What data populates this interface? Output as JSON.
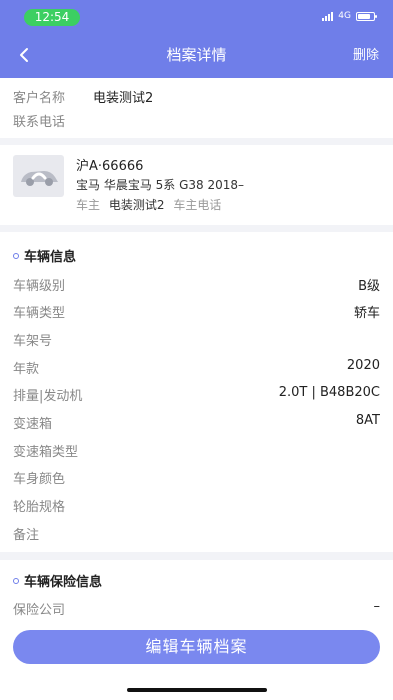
{
  "status_bar": {
    "time": "12:54",
    "network": "4G",
    "battery_level": 0.8
  },
  "header": {
    "title": "档案详情",
    "delete_label": "删除",
    "back_icon": "chevron-left-icon"
  },
  "customer": {
    "name_label": "客户名称",
    "name_value": "电装测试2",
    "phone_label": "联系电话",
    "phone_value": ""
  },
  "vehicle_card": {
    "plate": "沪A·66666",
    "model": "宝马 华晨宝马 5系 G38 2018–",
    "owner_label": "车主",
    "owner_value": "电装测试2",
    "owner_phone_label": "车主电话",
    "owner_phone_value": "",
    "thumb_icon": "car-placeholder-icon"
  },
  "vehicle_info": {
    "section_title": "车辆信息",
    "rows": [
      {
        "label": "车辆级别",
        "value": "B级"
      },
      {
        "label": "车辆类型",
        "value": "轿车"
      },
      {
        "label": "车架号",
        "value": ""
      },
      {
        "label": "年款",
        "value": "2020"
      },
      {
        "label": "排量|发动机",
        "value": "2.0T | B48B20C"
      },
      {
        "label": "变速箱",
        "value": "8AT"
      },
      {
        "label": "变速箱类型",
        "value": ""
      },
      {
        "label": "车身颜色",
        "value": ""
      },
      {
        "label": "轮胎规格",
        "value": ""
      },
      {
        "label": "备注",
        "value": ""
      }
    ]
  },
  "insurance_info": {
    "section_title": "车辆保险信息",
    "rows": [
      {
        "label": "保险公司",
        "value": "–"
      }
    ]
  },
  "edit_button_label": "编辑车辆档案",
  "colors": {
    "header": "#6f7ee9",
    "button": "#7a88ef",
    "status_pill": "#3ccf62"
  }
}
